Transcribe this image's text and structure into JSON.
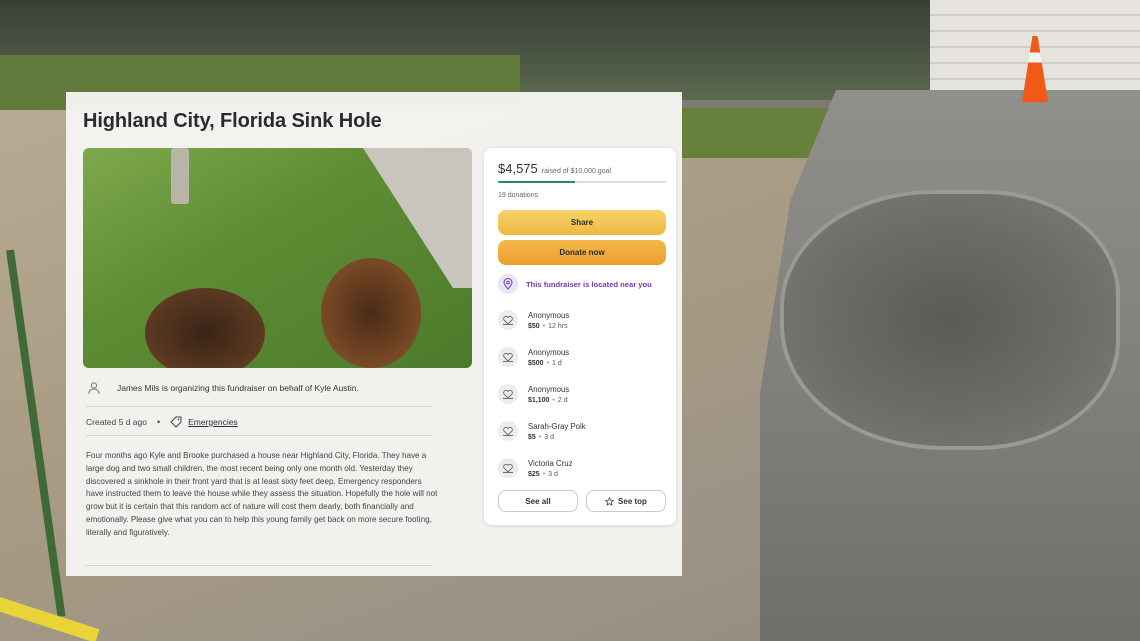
{
  "fundraiser": {
    "title": "Highland City, Florida Sink Hole",
    "organizer_text": "James Mils is organizing this fundraiser on behalf of Kyle Austin.",
    "created": "Created 5 d ago",
    "category": "Emergencies",
    "story": "Four months ago Kyle and Brooke purchased a house near Highland City, Florida. They have a large dog and two small children, the most recent being only one month old. Yesterday they discovered a sinkhole in their front yard that is at least sixty feet deep. Emergency responders have instructed them to leave the house while they assess the situation. Hopefully the hole will not grow but it is certain that this random act of nature will cost them dearly, both financially and emotionally. Please give what you can to help this young family get back on more secure footing, literally and figuratively."
  },
  "donate_panel": {
    "raised_amount": "$4,575",
    "goal_text": "raised of $10,000 goal",
    "progress_fraction": 0.4575,
    "donations_count": "19 donations",
    "share_label": "Share",
    "donate_label": "Donate now",
    "nearby_text": "This fundraiser is located near you",
    "donors": [
      {
        "name": "Anonymous",
        "amount": "$50",
        "time": "12 hrs"
      },
      {
        "name": "Anonymous",
        "amount": "$500",
        "time": "1 d"
      },
      {
        "name": "Anonymous",
        "amount": "$1,100",
        "time": "2 d"
      },
      {
        "name": "Sarah-Gray Polk",
        "amount": "$5",
        "time": "3 d"
      },
      {
        "name": "Victoria Cruz",
        "amount": "$25",
        "time": "3 d"
      }
    ],
    "see_all_label": "See all",
    "see_top_label": "See top"
  },
  "colors": {
    "progress": "#2f8a5b",
    "share_button": "#f2c857",
    "donate_button": "#efab3a",
    "nearby_text": "#6c3bb0"
  },
  "icons": [
    "person-icon",
    "tag-icon",
    "location-pin-icon",
    "donor-heart-icon",
    "star-icon"
  ]
}
